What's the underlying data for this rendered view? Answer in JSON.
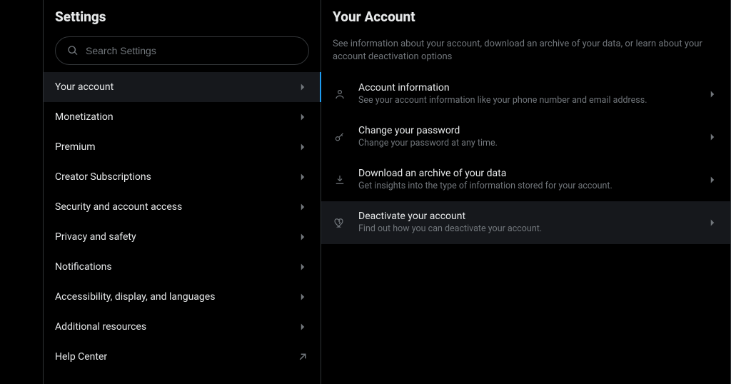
{
  "settings": {
    "title": "Settings",
    "search_placeholder": "Search Settings",
    "nav": [
      {
        "label": "Your account",
        "icon": "chevron-right",
        "selected": true
      },
      {
        "label": "Monetization",
        "icon": "chevron-right",
        "selected": false
      },
      {
        "label": "Premium",
        "icon": "chevron-right",
        "selected": false
      },
      {
        "label": "Creator Subscriptions",
        "icon": "chevron-right",
        "selected": false
      },
      {
        "label": "Security and account access",
        "icon": "chevron-right",
        "selected": false
      },
      {
        "label": "Privacy and safety",
        "icon": "chevron-right",
        "selected": false
      },
      {
        "label": "Notifications",
        "icon": "chevron-right",
        "selected": false
      },
      {
        "label": "Accessibility, display, and languages",
        "icon": "chevron-right",
        "selected": false
      },
      {
        "label": "Additional resources",
        "icon": "chevron-right",
        "selected": false
      },
      {
        "label": "Help Center",
        "icon": "external",
        "selected": false
      }
    ]
  },
  "detail": {
    "title": "Your Account",
    "description": "See information about your account, download an archive of your data, or learn about your account deactivation options",
    "items": [
      {
        "icon": "person",
        "title": "Account information",
        "subtitle": "See your account information like your phone number and email address.",
        "highlighted": false
      },
      {
        "icon": "key",
        "title": "Change your password",
        "subtitle": "Change your password at any time.",
        "highlighted": false
      },
      {
        "icon": "download",
        "title": "Download an archive of your data",
        "subtitle": "Get insights into the type of information stored for your account.",
        "highlighted": false
      },
      {
        "icon": "heart-broken",
        "title": "Deactivate your account",
        "subtitle": "Find out how you can deactivate your account.",
        "highlighted": true
      }
    ]
  }
}
